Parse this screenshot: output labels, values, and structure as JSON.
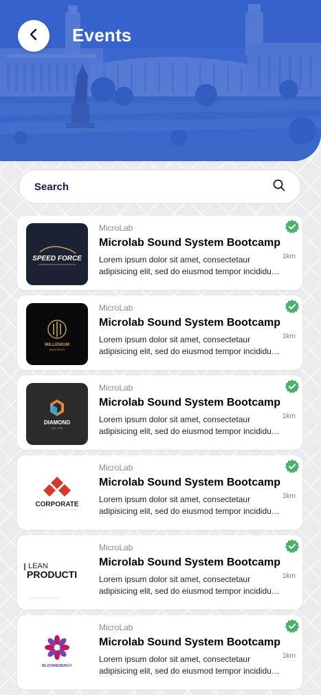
{
  "header": {
    "title": "Events",
    "back_icon": "chevron-left-icon"
  },
  "search": {
    "label": "Search",
    "icon": "search-icon"
  },
  "colors": {
    "header_blue": "#3b66cc",
    "verified_green": "#4caf6a",
    "text_dark": "#0f1b4d"
  },
  "events": [
    {
      "organizer": "MicroLab",
      "title": "Microlab Sound System Bootcamp",
      "description": "Lorem ipsum dolor sit amet, consectetaur adipisicing elit, sed do eiusmod tempor incididunt ut labore et dolore magna aliqua.",
      "distance": "1km",
      "logo": {
        "name": "SPEED FORCE",
        "tagline": "",
        "bg": "#1c2233"
      },
      "verified": true
    },
    {
      "organizer": "MicroLab",
      "title": "Microlab Sound System Bootcamp",
      "description": "Lorem ipsum dolor sit amet, consectetaur adipisicing elit, sed do eiusmod tempor incididunt ut labore et dolore magna aliqua.",
      "distance": "1km",
      "logo": {
        "name": "MILLENIUM",
        "tagline": "INVESTMENT",
        "bg": "#0a0a0a"
      },
      "verified": true
    },
    {
      "organizer": "MicroLab",
      "title": "Microlab Sound System Bootcamp",
      "description": "Lorem ipsum dolor sit amet, consectetaur adipisicing elit, sed do eiusmod tempor incididunt ut labore et dolore magna aliqua.",
      "distance": "1km",
      "logo": {
        "name": "DIAMOND",
        "tagline": "CO., LTD",
        "bg": "#2b2b2b"
      },
      "verified": true
    },
    {
      "organizer": "MicroLab",
      "title": "Microlab Sound System Bootcamp",
      "description": "Lorem ipsum dolor sit amet, consectetaur adipisicing elit, sed do eiusmod tempor incididunt ut labore et dolore magna aliqua.",
      "distance": "1km",
      "logo": {
        "name": "CORPORATE",
        "tagline": "",
        "bg": "#ffffff"
      },
      "verified": true
    },
    {
      "organizer": "MicroLab",
      "title": "Microlab Sound System Bootcamp",
      "description": "Lorem ipsum dolor sit amet, consectetaur adipisicing elit, sed do eiusmod tempor incididunt ut labore et dolore magna aliqua.",
      "distance": "1km",
      "logo": {
        "name": "LEAN",
        "tagline": "PRODUCTI",
        "bg": "#ffffff"
      },
      "verified": true
    },
    {
      "organizer": "MicroLab",
      "title": "Microlab Sound System Bootcamp",
      "description": "Lorem ipsum dolor sit amet, consectetaur adipisicing elit, sed do eiusmod tempor incididunt ut labore et dolore magna aliqua.",
      "distance": "1km",
      "logo": {
        "name": "BLOOMENERGY",
        "tagline": "",
        "bg": "#ffffff"
      },
      "verified": true
    }
  ]
}
